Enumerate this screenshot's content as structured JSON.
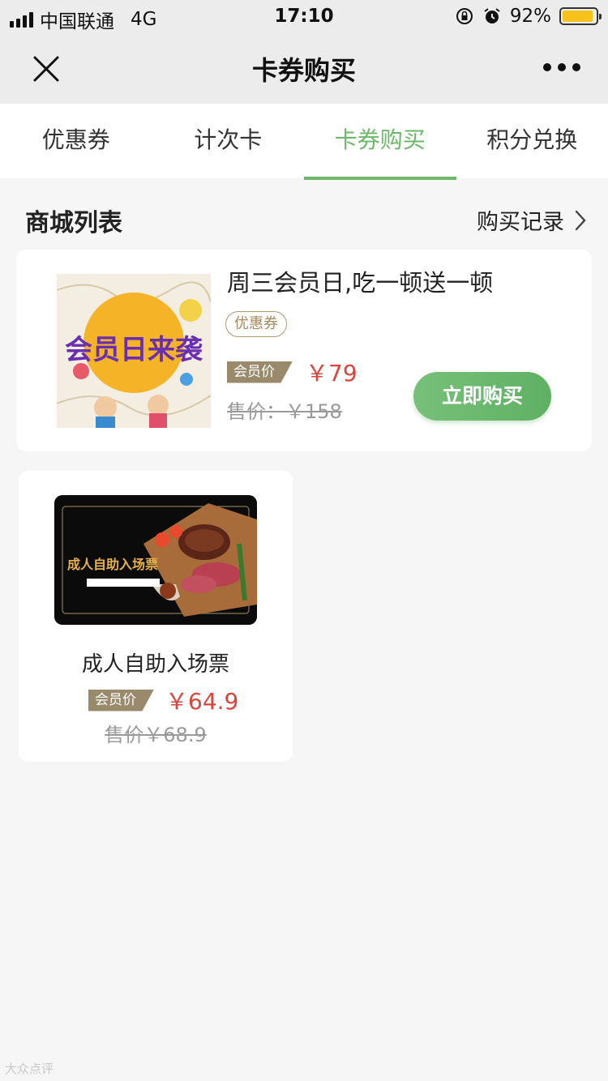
{
  "status_bar": {
    "carrier": "中国联通",
    "network": "4G",
    "time": "17:10",
    "battery": "92%",
    "battery_level": 0.92
  },
  "nav": {
    "title": "卡券购买"
  },
  "tabs": [
    {
      "label": "优惠券",
      "active": false
    },
    {
      "label": "计次卡",
      "active": false
    },
    {
      "label": "卡券购买",
      "active": true
    },
    {
      "label": "积分兑换",
      "active": false
    }
  ],
  "section": {
    "title": "商城列表",
    "record_link": "购买记录"
  },
  "products": [
    {
      "title": "周三会员日,吃一顿送一顿",
      "tag": "优惠券",
      "member_label": "会员价",
      "member_price": "￥79",
      "original_price": "售价：￥158",
      "buy_label": "立即购买",
      "image_text": "会员日来袭"
    },
    {
      "title": "成人自助入场票",
      "member_label": "会员价",
      "member_price": "￥64.9",
      "original_price": "售价￥68.9",
      "image_text": "成人自助入场票"
    }
  ],
  "watermark": "大众点评",
  "colors": {
    "accent_green": "#6db86a",
    "price_red": "#d9453c",
    "member_tag": "#9a8a6c"
  }
}
